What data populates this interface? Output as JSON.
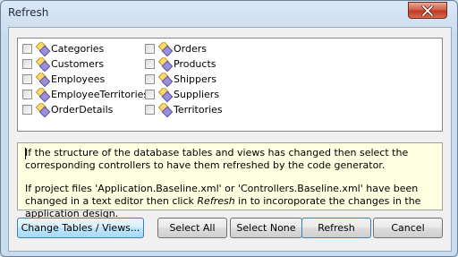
{
  "window": {
    "title": "Refresh"
  },
  "tables": [
    {
      "label": "Categories"
    },
    {
      "label": "Customers"
    },
    {
      "label": "Employees"
    },
    {
      "label": "EmployeeTerritories"
    },
    {
      "label": "OrderDetails"
    },
    {
      "label": "Orders"
    },
    {
      "label": "Products"
    },
    {
      "label": "Shippers"
    },
    {
      "label": "Suppliers"
    },
    {
      "label": "Territories"
    }
  ],
  "info": {
    "line1": "If the structure of the database tables and views has changed then select the corresponding controllers to have them refreshed by the code generator.",
    "line2_prefix": "If project files 'Application.Baseline.xml' or 'Controllers.Baseline.xml' have been changed in a text editor then click ",
    "line2_emph": "Refresh",
    "line2_suffix": " in to incoroporate the changes in the application design."
  },
  "buttons": {
    "change_tables": "Change Tables / Views...",
    "select_all": "Select All",
    "select_none": "Select None",
    "refresh": "Refresh",
    "cancel": "Cancel"
  },
  "icons": {
    "close": "close-x-icon",
    "table": "table-icon"
  },
  "colors": {
    "info_bg": "#ffffe1",
    "close_button": "#c0391f",
    "focus_border": "#3c7fb1"
  }
}
